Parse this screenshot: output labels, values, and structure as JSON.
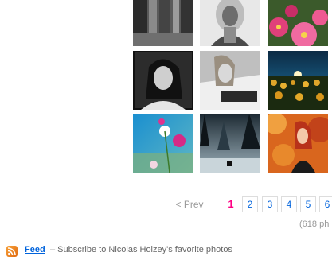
{
  "photos": [
    {
      "name": "photo-thumb-city-bw"
    },
    {
      "name": "photo-thumb-headscarf-portrait"
    },
    {
      "name": "photo-thumb-pink-flowers"
    },
    {
      "name": "photo-thumb-woman-portrait-bw"
    },
    {
      "name": "photo-thumb-woman-lying-bw"
    },
    {
      "name": "photo-thumb-sunflowers-sunset"
    },
    {
      "name": "photo-thumb-cosmos-flowers"
    },
    {
      "name": "photo-thumb-misty-forest"
    },
    {
      "name": "photo-thumb-redhead-autumn"
    }
  ],
  "pagination": {
    "prev_label": "< Prev",
    "current": "1",
    "pages": [
      "2",
      "3",
      "4",
      "5",
      "6"
    ],
    "count_text": "(618 ph"
  },
  "feed": {
    "link_label": "Feed",
    "description": "– Subscribe to Nicolas Hoizey's favorite photos",
    "icon": "rss-icon"
  },
  "colors": {
    "link": "#0063dc",
    "current_page": "#ff0084",
    "muted": "#999999",
    "rss": "#f7a23a"
  }
}
